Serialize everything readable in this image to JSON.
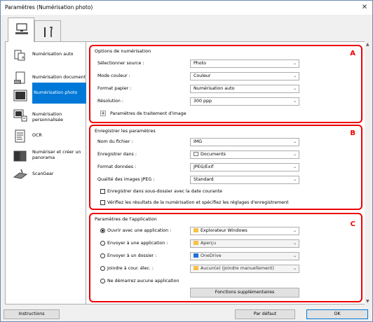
{
  "window": {
    "title": "Paramètres (Numérisation photo)",
    "close": "✕"
  },
  "sidebar": {
    "items": [
      {
        "label": "Numérisation auto"
      },
      {
        "label": "Numérisation document"
      },
      {
        "label": "Numérisation photo"
      },
      {
        "label": "Numérisation personnalisée"
      },
      {
        "label": "OCR"
      },
      {
        "label": "Numériser et créer un panorama"
      },
      {
        "label": "ScanGear"
      }
    ]
  },
  "sectionA": {
    "badge": "A",
    "title": "Options de numérisation",
    "source_label": "Sélectionner source :",
    "source_value": "Photo",
    "color_label": "Mode couleur :",
    "color_value": "Couleur",
    "paper_label": "Format papier :",
    "paper_value": "Numérisation auto",
    "res_label": "Résolution :",
    "res_value": "300 ppp",
    "image_settings": "Paramètres de traitement d'image"
  },
  "sectionB": {
    "badge": "B",
    "title": "Enregistrer les paramètres",
    "file_label": "Nom du fichier :",
    "file_value": "IMG",
    "save_label": "Enregistrer dans :",
    "save_value": "Documents",
    "format_label": "Format données :",
    "format_value": "JPEG/Exif",
    "quality_label": "Qualité des images JPEG :",
    "quality_value": "Standard",
    "subfolder": "Enregistrer dans sous-dossier avec la date courante",
    "verify": "Vérifiez les résultats de la numérisation et spécifiez les réglages d'enregistrement"
  },
  "sectionC": {
    "badge": "C",
    "title": "Paramètres de l'application",
    "open_label": "Ouvrir avec une application :",
    "open_value": "Explorateur Windows",
    "send_app_label": "Envoyer à une application :",
    "send_app_value": "Aperçu",
    "send_folder_label": "Envoyer à un dossier :",
    "send_folder_value": "OneDrive",
    "email_label": "Joindre à cour. élec. :",
    "email_value": "Aucun(e) (Joindre manuellement)",
    "none_label": "Ne démarrez aucune application",
    "more_button": "Fonctions supplémentaires"
  },
  "footer": {
    "instructions": "Instructions",
    "default": "Par défaut",
    "ok": "OK"
  },
  "colors": {
    "accent": "#0078d7",
    "highlight_border": "#e00000"
  }
}
